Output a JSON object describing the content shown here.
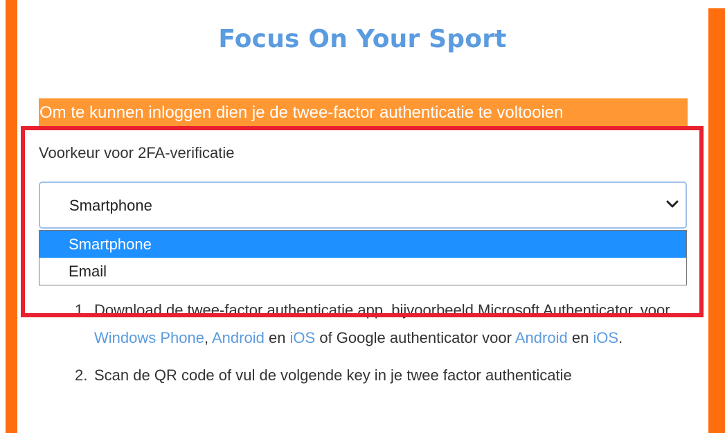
{
  "header": {
    "title": "Focus On Your Sport"
  },
  "notice": {
    "text": "Om te kunnen inloggen dien je de twee-factor authenticatie te voltooien"
  },
  "two_factor": {
    "label": "Voorkeur voor 2FA-verificatie",
    "selected_value": "Smartphone",
    "options": [
      {
        "label": "Smartphone",
        "selected": true
      },
      {
        "label": "Email",
        "selected": false
      }
    ]
  },
  "steps": [
    {
      "number": "1.",
      "parts": {
        "p1": "Download de twee-factor authenticatie app, bijvoorbeeld Microsoft Authenticator, voor ",
        "link1": "Windows Phone",
        "p2": ", ",
        "link2": "Android",
        "p3": " en ",
        "link3": "iOS",
        "p4": " of Google authenticator voor ",
        "link4": "Android",
        "p5": " en ",
        "link5": "iOS",
        "p6": "."
      }
    },
    {
      "number": "2.",
      "text": "Scan de QR code of vul de volgende key in je twee factor authenticatie"
    }
  ],
  "colors": {
    "accent_orange": "#ff6d0f",
    "notice_orange": "#ff9733",
    "title_blue": "#5b9bdf",
    "highlight_red": "#e8202f",
    "option_selected_blue": "#1e90ff"
  }
}
